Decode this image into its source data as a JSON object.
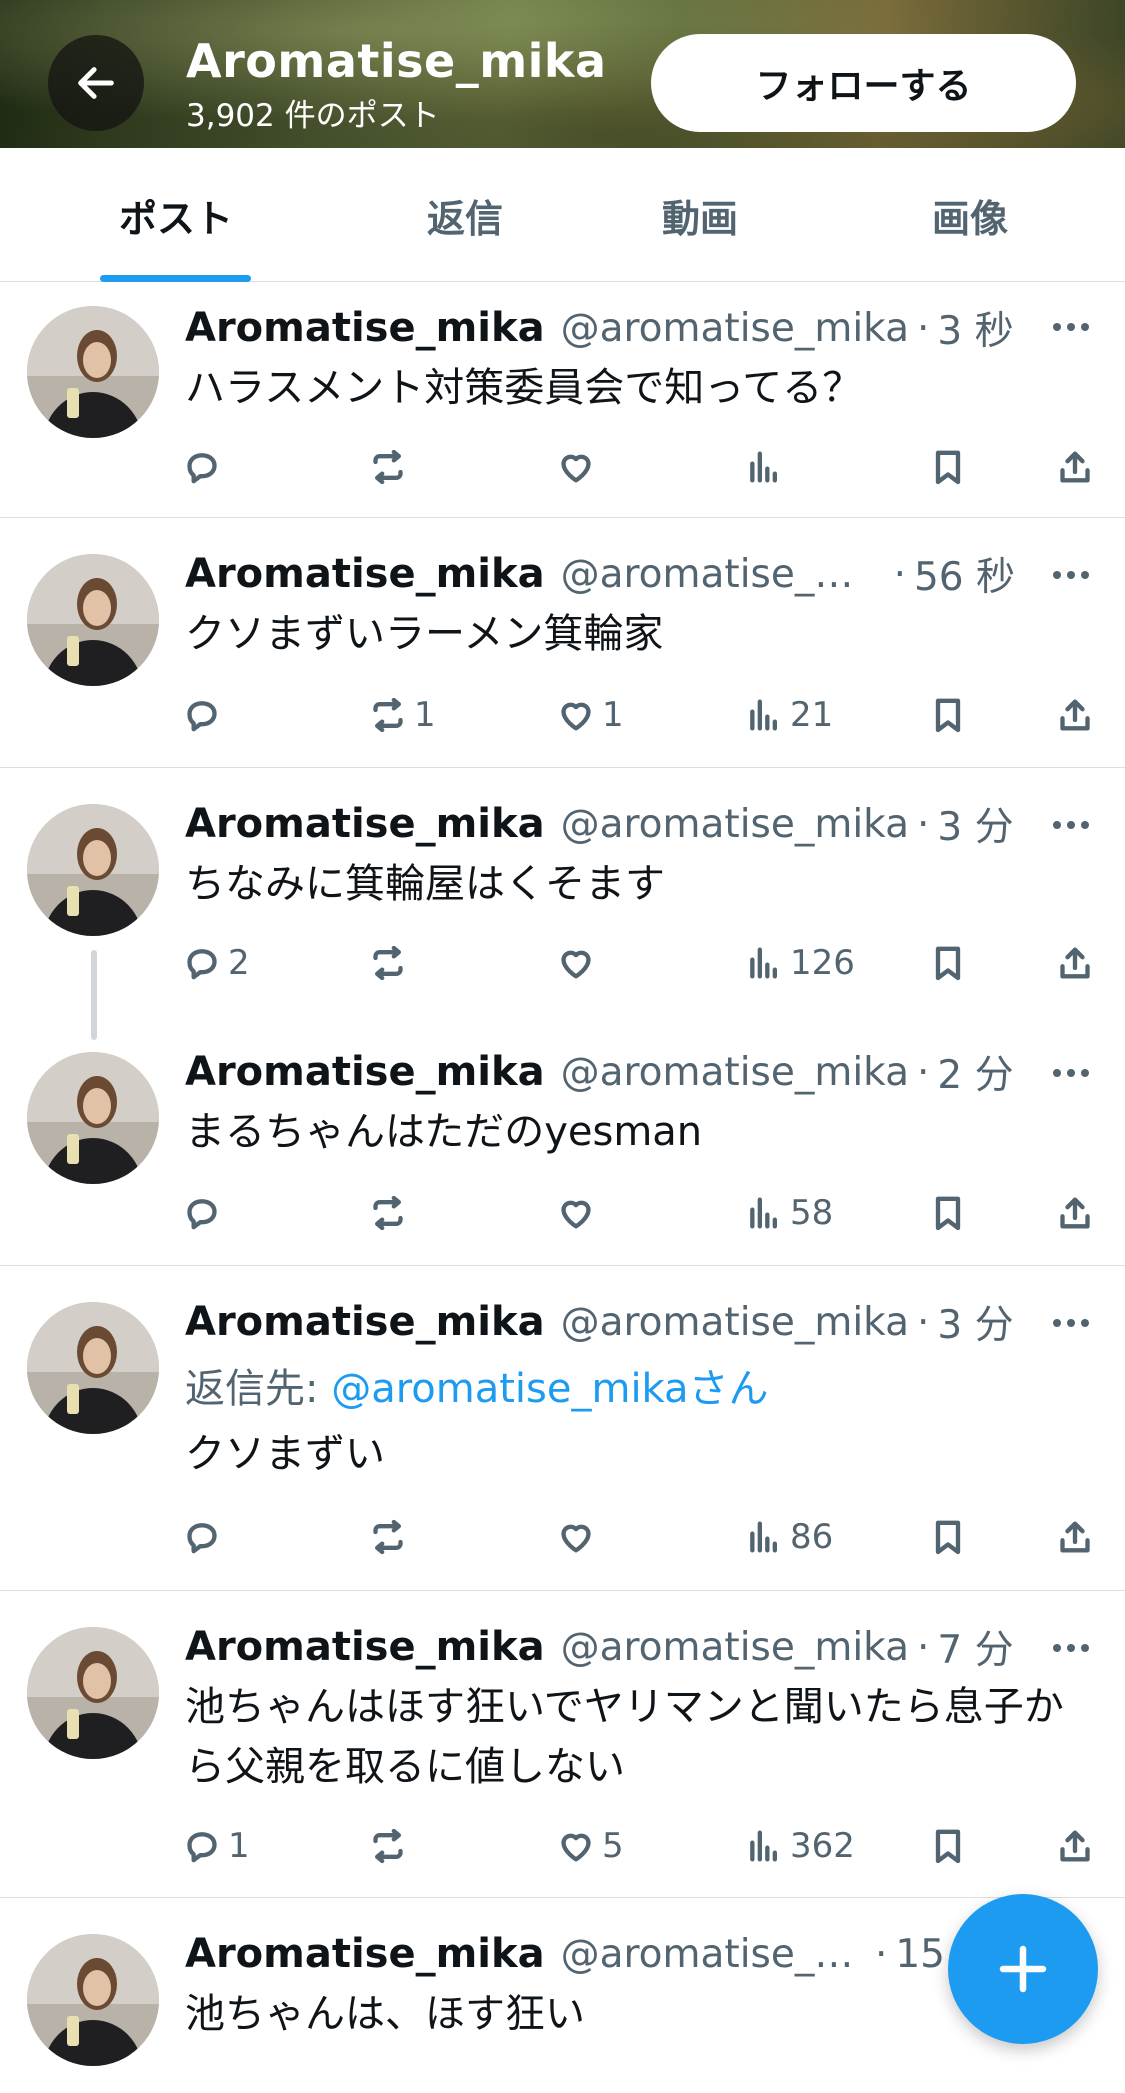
{
  "header": {
    "name": "Aromatise_mika",
    "post_count": "3,902 件のポスト",
    "follow_label": "フォローする"
  },
  "tabs": [
    {
      "label": "ポスト",
      "active": true
    },
    {
      "label": "返信",
      "active": false
    },
    {
      "label": "動画",
      "active": false
    },
    {
      "label": "画像",
      "active": false
    }
  ],
  "colors": {
    "accent": "#1d9bf0",
    "muted": "#536471",
    "text": "#0f1419"
  },
  "icons": [
    "back-arrow-icon",
    "reply-icon",
    "repost-icon",
    "like-icon",
    "views-icon",
    "bookmark-icon",
    "share-icon",
    "more-icon",
    "compose-plus-icon"
  ],
  "posts": [
    {
      "name": "Aromatise_mika",
      "handle": "@aromatise_mika",
      "time": "3 秒",
      "text": "ハラスメント対策委員会で知ってる？",
      "replies": "",
      "reposts": "",
      "likes": "",
      "views": ""
    },
    {
      "name": "Aromatise_mika",
      "handle": "@aromatise_m…",
      "time": "56 秒",
      "text": "クソまずいラーメン箕輪家",
      "replies": "",
      "reposts": "1",
      "likes": "1",
      "views": "21"
    },
    {
      "name": "Aromatise_mika",
      "handle": "@aromatise_mika",
      "time": "3 分",
      "text": "ちなみに箕輪屋はくそます",
      "replies": "2",
      "reposts": "",
      "likes": "",
      "views": "126"
    },
    {
      "name": "Aromatise_mika",
      "handle": "@aromatise_mika",
      "time": "2 分",
      "text": "まるちゃんはただのyesman",
      "replies": "",
      "reposts": "",
      "likes": "",
      "views": "58"
    },
    {
      "name": "Aromatise_mika",
      "handle": "@aromatise_mika",
      "time": "3 分",
      "reply_prefix": "返信先:",
      "reply_handle": "@aromatise_mika",
      "reply_suffix": "さん",
      "text": "クソまずい",
      "replies": "",
      "reposts": "",
      "likes": "",
      "views": "86"
    },
    {
      "name": "Aromatise_mika",
      "handle": "@aromatise_mika",
      "time": "7 分",
      "text": "池ちゃんはほす狂いでヤリマンと聞いたら息子から父親を取るに値しない",
      "replies": "1",
      "reposts": "",
      "likes": "5",
      "views": "362"
    },
    {
      "name": "Aromatise_mika",
      "handle": "@aromatise_mi…",
      "time": "15",
      "text": "池ちゃんは、ほす狂い"
    }
  ]
}
